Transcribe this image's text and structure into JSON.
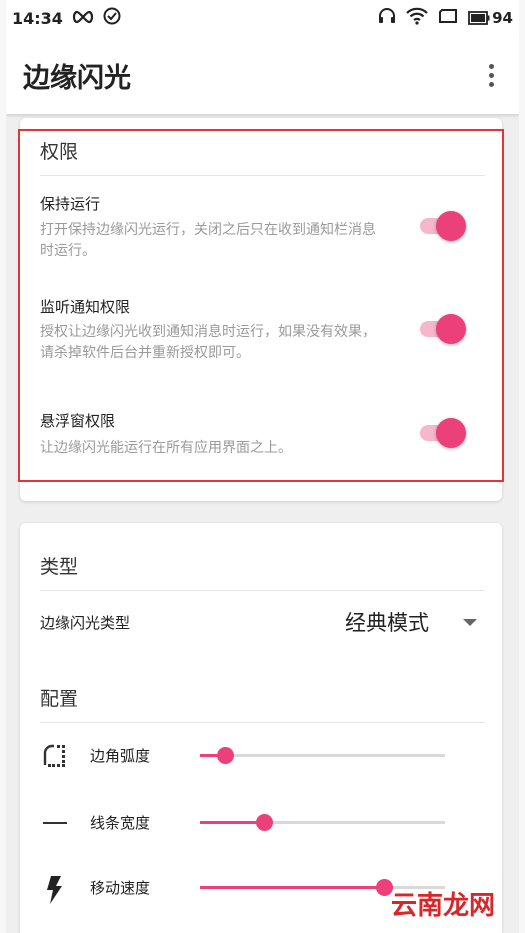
{
  "status_bar": {
    "time": "14:34",
    "left_icons": [
      "infinity-icon",
      "check-circle-icon"
    ],
    "right_icons": [
      "headset-icon",
      "wifi-icon",
      "screen-icon"
    ],
    "battery": "94"
  },
  "app_bar": {
    "title": "边缘闪光",
    "overflow_icon": "more-vert-icon"
  },
  "permissions": {
    "title": "权限",
    "items": [
      {
        "title": "保持运行",
        "summary": "打开保持边缘闪光运行，关闭之后只在收到通知栏消息时运行。",
        "enabled": true
      },
      {
        "title": "监听通知权限",
        "summary": "授权让边缘闪光收到通知消息时运行，如果没有效果，请杀掉软件后台并重新授权即可。",
        "enabled": true
      },
      {
        "title": "悬浮窗权限",
        "summary": "让边缘闪光能运行在所有应用界面之上。",
        "enabled": true
      }
    ]
  },
  "type_section": {
    "title": "类型",
    "dropdown_label": "边缘闪光类型",
    "dropdown_value": "经典模式"
  },
  "config_section": {
    "title": "配置",
    "sliders": [
      {
        "label": "边角弧度",
        "icon": "rounded-corner-icon",
        "value": 0.1
      },
      {
        "label": "线条宽度",
        "icon": "line-width-icon",
        "value": 0.26
      },
      {
        "label": "移动速度",
        "icon": "flash-icon",
        "value": 0.75
      }
    ]
  },
  "watermark": "云南龙网",
  "colors": {
    "accent": "#ec407a",
    "accent_track": "#f6b6cb",
    "highlight_border": "#e2353a"
  }
}
